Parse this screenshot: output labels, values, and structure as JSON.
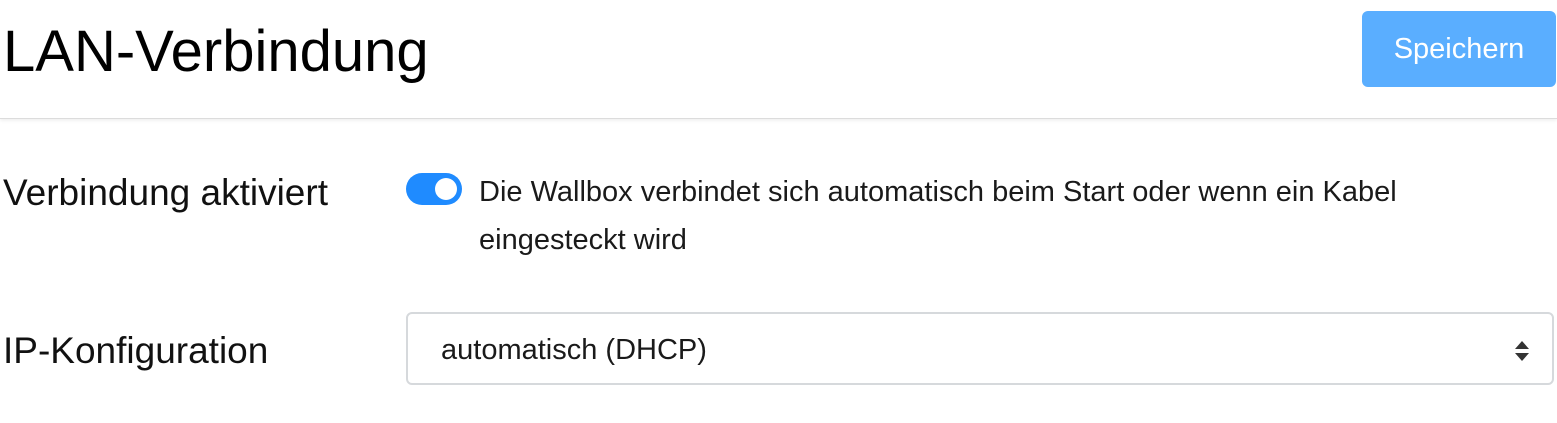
{
  "header": {
    "title": "LAN-Verbindung",
    "save_label": "Speichern"
  },
  "connection": {
    "label": "Verbindung aktiviert",
    "enabled": true,
    "description": "Die Wallbox verbindet sich automatisch beim Start oder wenn ein Kabel eingesteckt wird"
  },
  "ip_config": {
    "label": "IP-Konfiguration",
    "selected": "automatisch (DHCP)"
  },
  "icons": {
    "toggle": "toggle-switch-on",
    "select": "sort-arrows-icon"
  },
  "colors": {
    "accent": "#1f8bff",
    "save_button": "#5aaeff"
  }
}
